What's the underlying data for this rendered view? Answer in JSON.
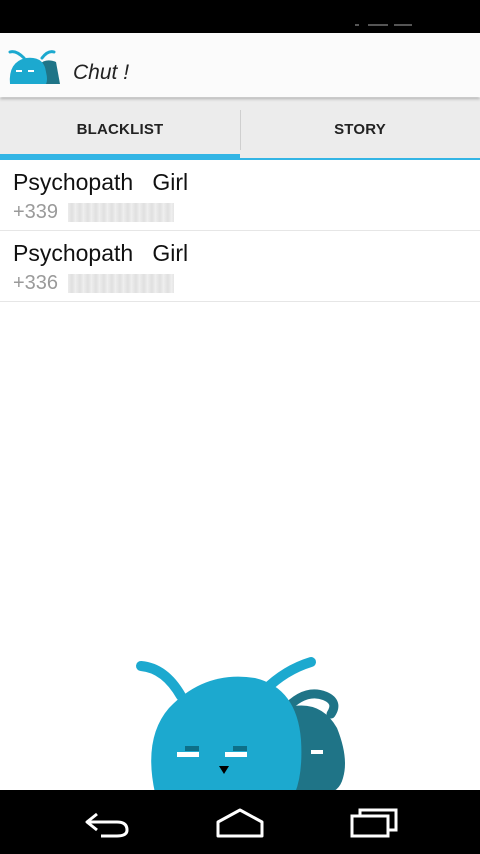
{
  "app": {
    "title": "Chut !"
  },
  "tabs": [
    {
      "label": "BLACKLIST",
      "selected": true
    },
    {
      "label": "STORY",
      "selected": false
    }
  ],
  "contacts": [
    {
      "name": "Psychopath   Girl",
      "number_prefix": "+339"
    },
    {
      "name": "Psychopath   Girl",
      "number_prefix": "+336"
    }
  ],
  "colors": {
    "accent": "#33b5e5",
    "mascot_primary": "#1ca9cf",
    "mascot_secondary": "#1f7487"
  },
  "icons": {
    "logo": "app-logo-icon",
    "mascot": "mascot-illustration",
    "nav": [
      "back-icon",
      "home-icon",
      "recent-apps-icon"
    ]
  }
}
